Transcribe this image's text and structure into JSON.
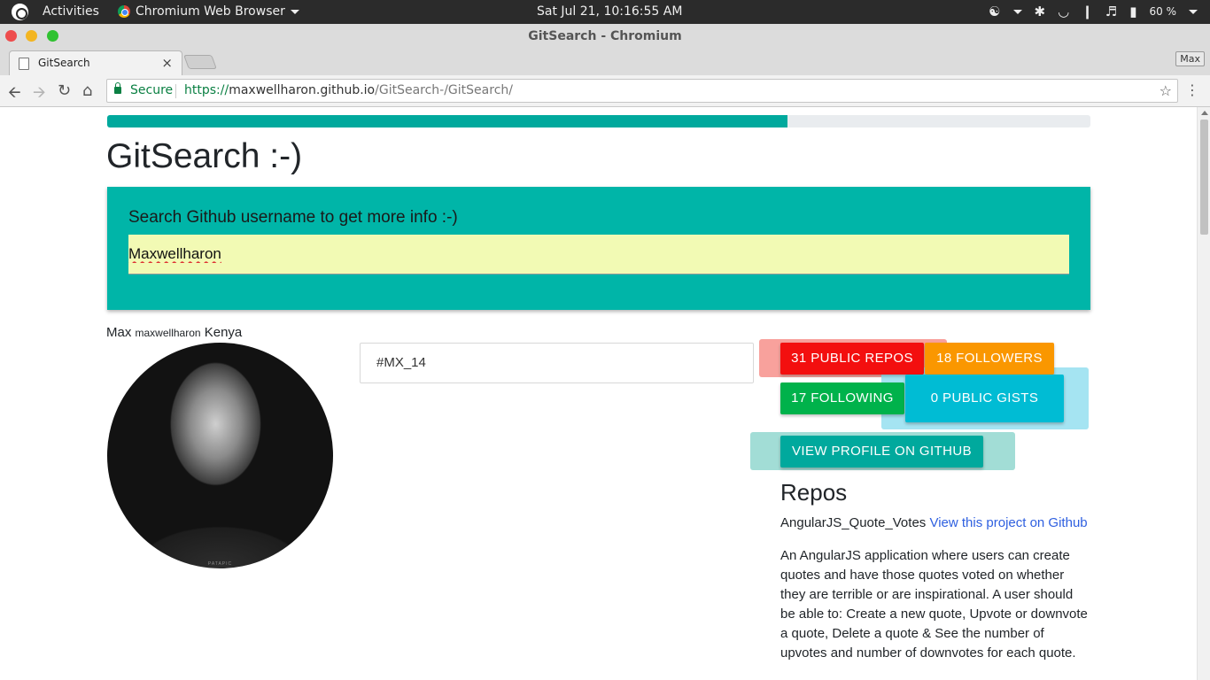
{
  "system": {
    "activities": "Activities",
    "app_menu": "Chromium Web Browser",
    "clock": "Sat Jul 21, 10:16:55 AM",
    "battery": "60 %"
  },
  "window": {
    "title": "GitSearch - Chromium",
    "tab_label": "GitSearch",
    "profile": "Max"
  },
  "address_bar": {
    "secure_label": "Secure",
    "url_scheme": "https://",
    "url_host": "maxwellharon.github.io",
    "url_path": "/GitSearch-/GitSearch/"
  },
  "page": {
    "progress": 0.692,
    "progress_color": "#00a99d",
    "title": "GitSearch :-)",
    "search": {
      "prompt": "Search Github username to get more info :-)",
      "value": "Maxwellharon"
    },
    "user": {
      "name": "Max",
      "login": "maxwellharon",
      "location": "Kenya",
      "bio": "#MX_14"
    },
    "stats": {
      "repos": "31 PUBLIC REPOS",
      "followers": "18 FOLLOWERS",
      "following": "17 FOLLOWING",
      "gists": "0 PUBLIC GISTS",
      "profile_button": "VIEW PROFILE ON GITHUB"
    },
    "repos": {
      "heading": "Repos",
      "items": [
        {
          "name": "AngularJS_Quote_Votes",
          "link": "View this project on Github",
          "description": "An AngularJS application where users can create quotes and have those quotes voted on whether they are terrible or are inspirational. A user should be able to: Create a new quote, Upvote or downvote a quote, Delete a quote & See the number of upvotes and number of downvotes for each quote."
        }
      ]
    }
  }
}
